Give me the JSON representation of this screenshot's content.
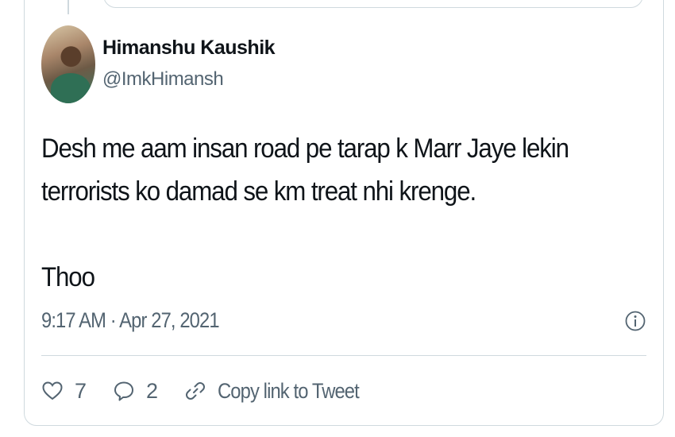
{
  "tweet": {
    "author": {
      "name": "Himanshu Kaushik",
      "handle": "@ImkHimansh"
    },
    "text_lines": [
      "Desh me aam insan road pe tarap k Marr Jaye lekin",
      "terrorists ko damad se km treat nhi krenge.",
      "Thoo"
    ],
    "timestamp": "9:17 AM · Apr 27, 2021",
    "actions": {
      "likes": "7",
      "replies": "2",
      "copy_link_label": "Copy link to Tweet"
    }
  },
  "icons": {
    "like": "heart-icon",
    "reply": "speech-bubble-icon",
    "copy_link": "link-icon",
    "info": "info-icon"
  },
  "colors": {
    "text": "#0f1419",
    "secondary": "#536471",
    "border": "#cfd9de"
  }
}
